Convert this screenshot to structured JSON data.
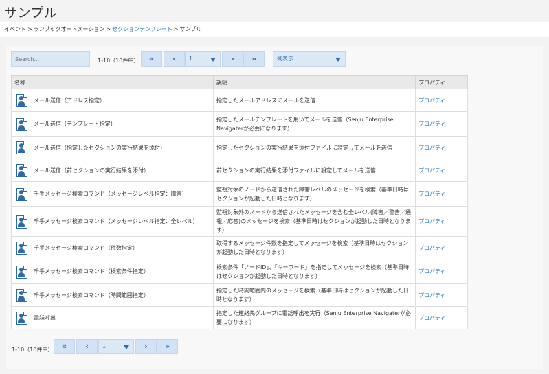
{
  "page": {
    "title": "サンプル"
  },
  "breadcrumb": {
    "items": [
      "イベント",
      "ランブックオートメーション",
      "セクションテンプレート",
      "サンプル"
    ],
    "separator": ">"
  },
  "toolbar": {
    "search_placeholder": "Search...",
    "range_text": "1-10（10件中）",
    "first_btn": "«",
    "prev_btn": "‹",
    "page_value": "1",
    "next_btn": "›",
    "last_btn": "»",
    "view_select": "列表示"
  },
  "table": {
    "headers": [
      "名称",
      "説明",
      "プロパティ"
    ],
    "rows": [
      {
        "name": "メール送信（アドレス指定）",
        "description": "指定したメールアドレスにメールを送信",
        "property": "プロパティ"
      },
      {
        "name": "メール送信（テンプレート指定）",
        "description": "指定したメールテンプレートを用いてメールを送信（Senju Enterprise Navigaterが必要になります）",
        "property": "プロパティ"
      },
      {
        "name": "メール送信（指定したセクションの実行結果を添付）",
        "description": "指定したセクションの実行結果を添付ファイルに設定してメールを送信",
        "property": "プロパティ"
      },
      {
        "name": "メール送信（前セクションの実行結果を添付）",
        "description": "前セクションの実行結果を添付ファイルに設定してメールを送信",
        "property": "プロパティ"
      },
      {
        "name": "千手メッセージ検索コマンド（メッセージレベル指定：障害）",
        "description": "監視対象のノードから送信された障害レベルのメッセージを検索（基準日時はセクションが起動した日時となります）",
        "property": "プロパティ"
      },
      {
        "name": "千手メッセージ検索コマンド（メッセージレベル指定：全レベル）",
        "description": "監視対象外のノードから送信されたメッセージを含む全レベル(障害／警告／通報／応答)のメッセージを検索（基準日時はセクションが起動した日時となります）",
        "property": "プロパティ"
      },
      {
        "name": "千手メッセージ検索コマンド（件数指定）",
        "description": "取得するメッセージ件数を指定してメッセージを検索（基準日時はセクションが起動した日時となります）",
        "property": "プロパティ"
      },
      {
        "name": "千手メッセージ検索コマンド（検索条件指定）",
        "description": "検索条件「ノードID」、「キーワード」を指定してメッセージを検索（基準日時はセクションが起動した日時となります）",
        "property": "プロパティ"
      },
      {
        "name": "千手メッセージ検索コマンド（時間範囲指定）",
        "description": "指定した時間範囲内のメッセージを検索（基準日時はセクションが起動した日時となります）",
        "property": "プロパティ"
      },
      {
        "name": "電話呼出",
        "description": "指定した連絡先グループに電話呼出を実行（Senju Enterprise Navigaterが必要になります）",
        "property": "プロパティ"
      }
    ]
  },
  "pager_bottom": {
    "range_text": "1-10（10件中）",
    "first_btn": "«",
    "prev_btn": "‹",
    "page_value": "1",
    "next_btn": "›",
    "last_btn": "»"
  }
}
